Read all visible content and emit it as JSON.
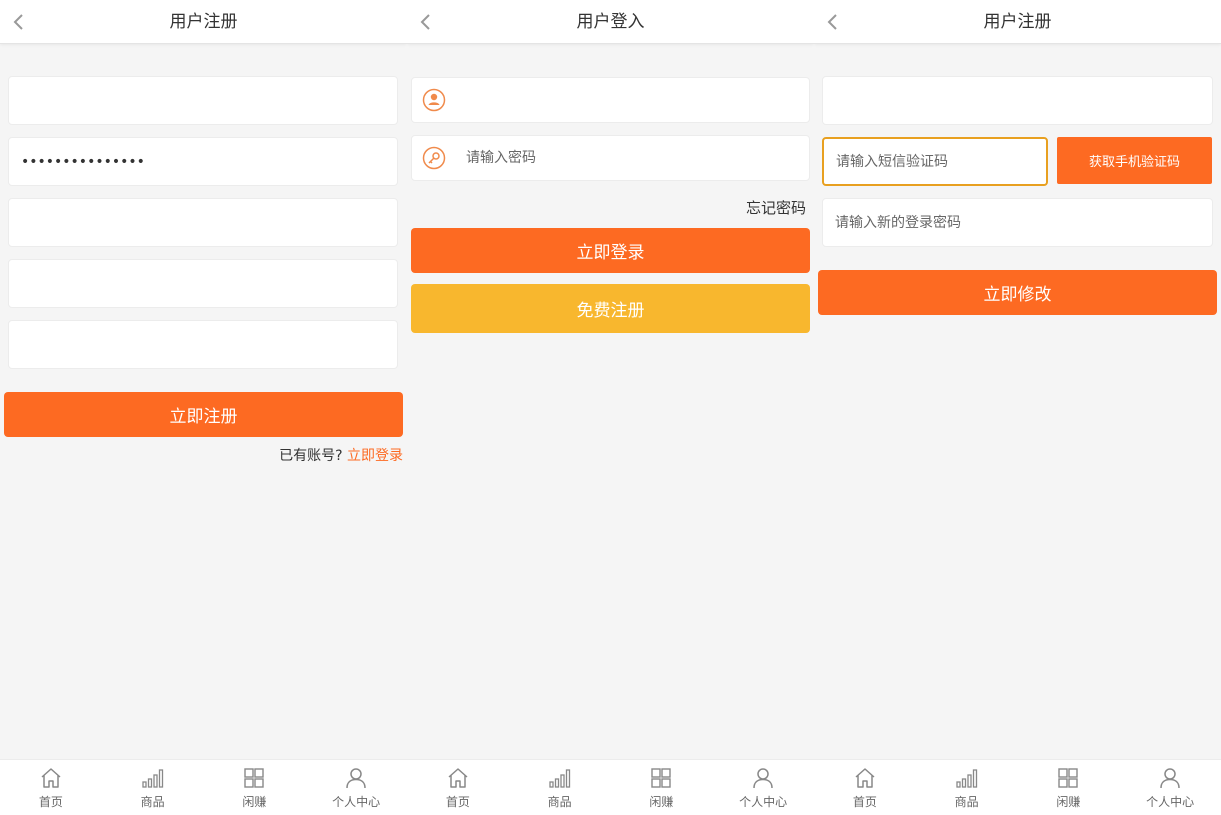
{
  "tabbar": {
    "items": [
      {
        "label": "首页",
        "icon": "home-icon"
      },
      {
        "label": "商品",
        "icon": "bar-chart-icon"
      },
      {
        "label": "闲赚",
        "icon": "grid-icon"
      },
      {
        "label": "个人中心",
        "icon": "user-icon"
      }
    ]
  },
  "register": {
    "title": "用户注册",
    "fields": [
      {
        "value": "",
        "placeholder": ""
      },
      {
        "value": "•••••••••••••••",
        "placeholder": ""
      },
      {
        "value": "",
        "placeholder": ""
      },
      {
        "value": "",
        "placeholder": ""
      },
      {
        "value": "",
        "placeholder": ""
      }
    ],
    "submit_label": "立即注册",
    "has_account_text": "已有账号?",
    "login_link": "立即登录"
  },
  "login": {
    "title": "用户登入",
    "username_placeholder": "",
    "password_placeholder": "请输入密码",
    "forgot_password": "忘记密码",
    "login_label": "立即登录",
    "register_label": "免费注册"
  },
  "reset": {
    "title": "用户注册",
    "phone_placeholder": "",
    "sms_code_placeholder": "请输入短信验证码",
    "get_code_label": "获取手机验证码",
    "new_password_placeholder": "请输入新的登录密码",
    "submit_label": "立即修改"
  },
  "colors": {
    "accent": "#fd6a22",
    "secondary": "#f8b72e",
    "focus_border": "#e8a020"
  }
}
